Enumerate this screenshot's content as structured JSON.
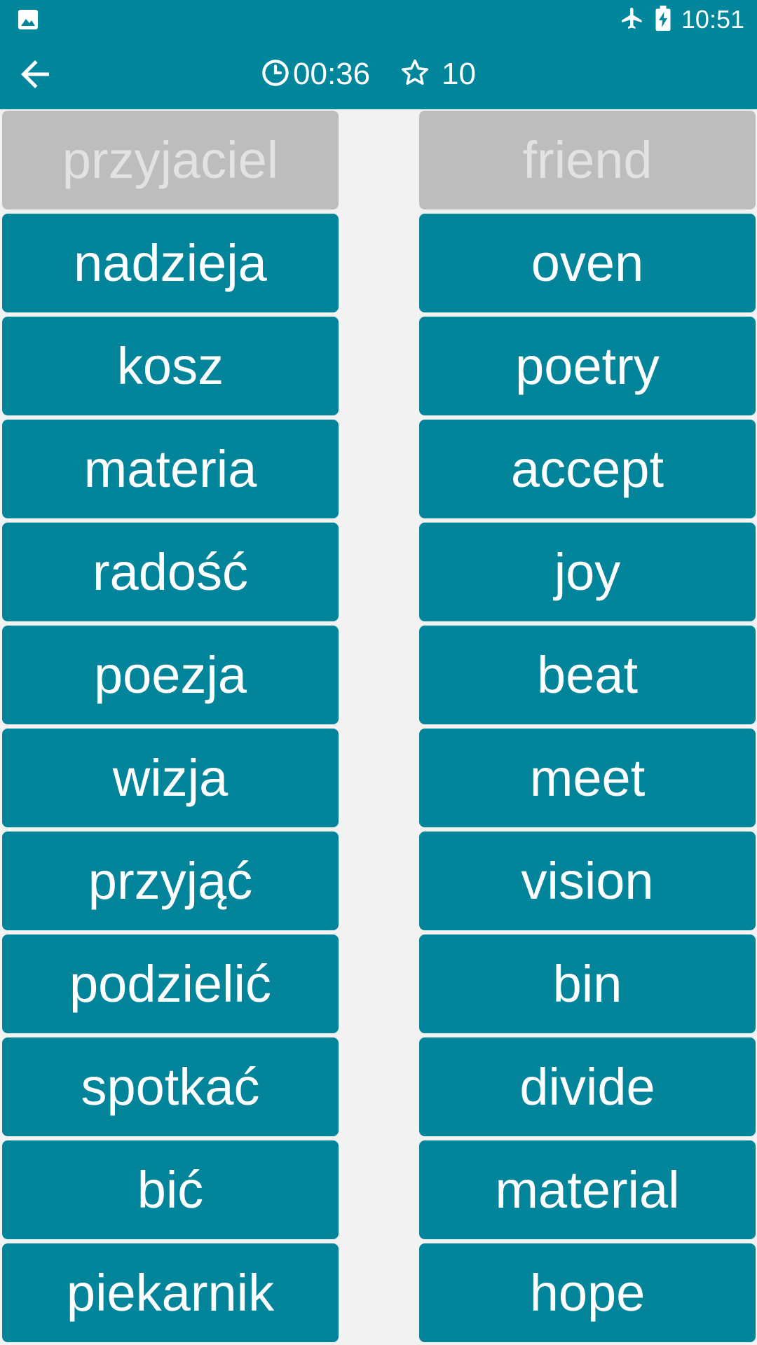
{
  "status_bar": {
    "time": "10:51",
    "icons": [
      "image-icon",
      "airplane-icon",
      "battery-charging-icon"
    ]
  },
  "app_bar": {
    "back_icon": "arrow-left-icon",
    "timer_icon": "clock-icon",
    "timer": "00:36",
    "score_icon": "star-outline-icon",
    "score": "10"
  },
  "colors": {
    "primary": "#02869b",
    "tile": "#02859a",
    "tile_matched": "#bdbdbd",
    "matched_text": "#e2e2e2",
    "background": "#f2f2f2"
  },
  "left_words": [
    {
      "text": "przyjaciel",
      "matched": true
    },
    {
      "text": "nadzieja",
      "matched": false
    },
    {
      "text": "kosz",
      "matched": false
    },
    {
      "text": "materia",
      "matched": false
    },
    {
      "text": "radość",
      "matched": false
    },
    {
      "text": "poezja",
      "matched": false
    },
    {
      "text": "wizja",
      "matched": false
    },
    {
      "text": "przyjąć",
      "matched": false
    },
    {
      "text": "podzielić",
      "matched": false
    },
    {
      "text": "spotkać",
      "matched": false
    },
    {
      "text": "bić",
      "matched": false
    },
    {
      "text": "piekarnik",
      "matched": false
    }
  ],
  "right_words": [
    {
      "text": "friend",
      "matched": true
    },
    {
      "text": "oven",
      "matched": false
    },
    {
      "text": "poetry",
      "matched": false
    },
    {
      "text": "accept",
      "matched": false
    },
    {
      "text": "joy",
      "matched": false
    },
    {
      "text": "beat",
      "matched": false
    },
    {
      "text": "meet",
      "matched": false
    },
    {
      "text": "vision",
      "matched": false
    },
    {
      "text": "bin",
      "matched": false
    },
    {
      "text": "divide",
      "matched": false
    },
    {
      "text": "material",
      "matched": false
    },
    {
      "text": "hope",
      "matched": false
    }
  ]
}
